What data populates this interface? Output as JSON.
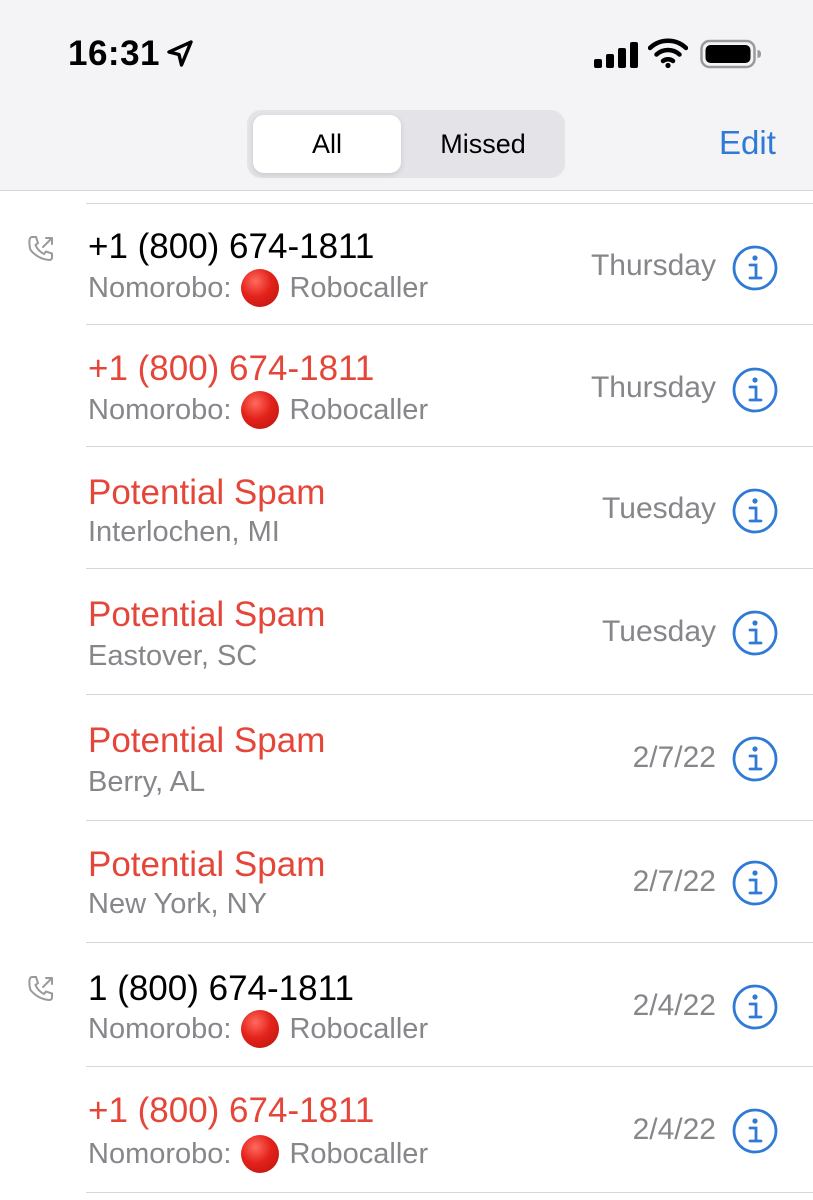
{
  "status_bar": {
    "time": "16:31",
    "location_icon": "location-arrow-icon",
    "signal_icon": "cellular-signal-icon",
    "wifi_icon": "wifi-icon",
    "battery_icon": "battery-icon"
  },
  "nav": {
    "segments": [
      "All",
      "Missed"
    ],
    "selected": "All",
    "edit_label": "Edit"
  },
  "colors": {
    "accent": "#2f7ad6",
    "missed_red": "#e5463a",
    "secondary_text": "#86868b",
    "separator": "#d6d6d8"
  },
  "calls": [
    {
      "name": "+1 (800) 674-1811",
      "detail_prefix": "Nomorobo:",
      "detail_suffix": "Robocaller",
      "has_dot": true,
      "date": "Thursday",
      "missed": false,
      "outgoing": true
    },
    {
      "name": "+1 (800) 674-1811",
      "detail_prefix": "Nomorobo:",
      "detail_suffix": "Robocaller",
      "has_dot": true,
      "date": "Thursday",
      "missed": true,
      "outgoing": false
    },
    {
      "name": "Potential Spam",
      "detail_prefix": "Interlochen, MI",
      "detail_suffix": "",
      "has_dot": false,
      "date": "Tuesday",
      "missed": true,
      "outgoing": false
    },
    {
      "name": "Potential Spam",
      "detail_prefix": "Eastover, SC",
      "detail_suffix": "",
      "has_dot": false,
      "date": "Tuesday",
      "missed": true,
      "outgoing": false
    },
    {
      "name": "Potential Spam",
      "detail_prefix": "Berry, AL",
      "detail_suffix": "",
      "has_dot": false,
      "date": "2/7/22",
      "missed": true,
      "outgoing": false
    },
    {
      "name": "Potential Spam",
      "detail_prefix": "New York, NY",
      "detail_suffix": "",
      "has_dot": false,
      "date": "2/7/22",
      "missed": true,
      "outgoing": false
    },
    {
      "name": "1 (800) 674-1811",
      "detail_prefix": "Nomorobo:",
      "detail_suffix": "Robocaller",
      "has_dot": true,
      "date": "2/4/22",
      "missed": false,
      "outgoing": true
    },
    {
      "name": "+1 (800) 674-1811",
      "detail_prefix": "Nomorobo:",
      "detail_suffix": "Robocaller",
      "has_dot": true,
      "date": "2/4/22",
      "missed": true,
      "outgoing": false
    }
  ]
}
